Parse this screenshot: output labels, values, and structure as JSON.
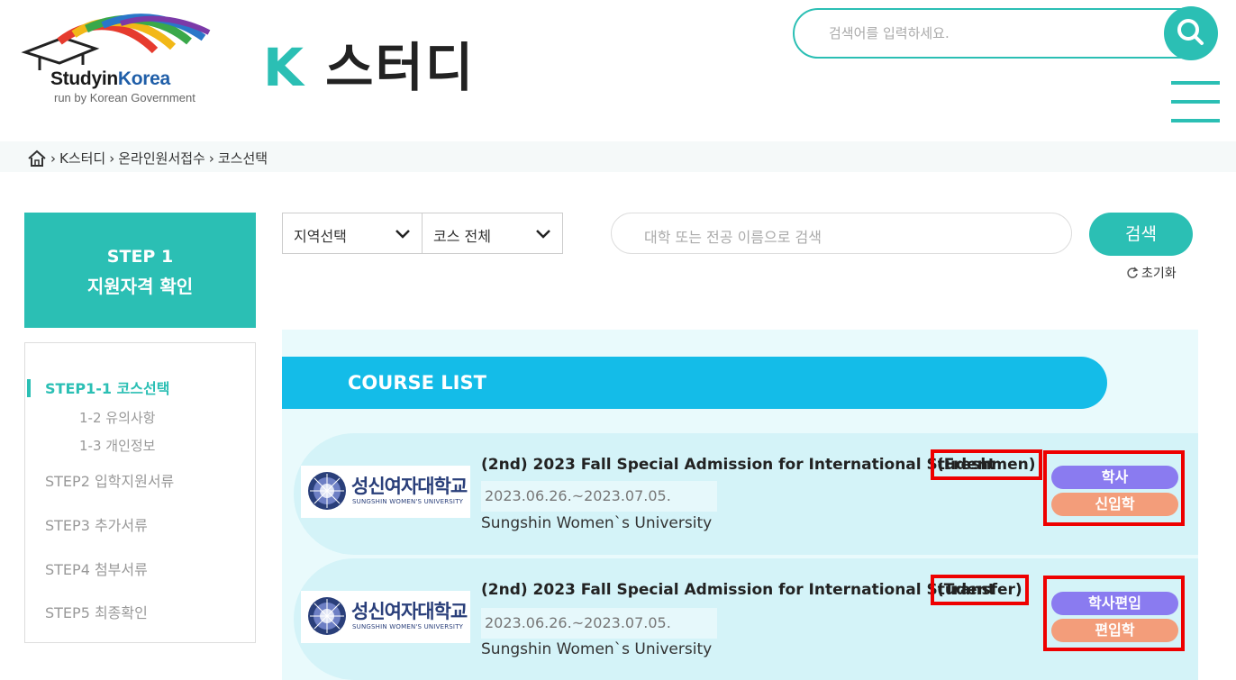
{
  "header": {
    "brand_study": "Studyin",
    "brand_korea": "Korea",
    "brand_sub": "run by Korean Government",
    "site_title_k": "K",
    "site_title_rest": "스터디",
    "search_placeholder": "검색어를 입력하세요."
  },
  "breadcrumb": {
    "items": [
      "K스터디",
      "온라인원서접수",
      "코스선택"
    ]
  },
  "sidebar": {
    "step_title": "STEP 1",
    "step_subtitle": "지원자격 확인",
    "nav": {
      "step1_1": "STEP1-1 코스선택",
      "sub_1_2": "1-2 유의사항",
      "sub_1_3": "1-3 개인정보",
      "step2": "STEP2 입학지원서류",
      "step3": "STEP3 추가서류",
      "step4": "STEP4 첨부서류",
      "step5": "STEP5 최종확인"
    }
  },
  "filters": {
    "region_select": "지역선택",
    "course_select": "코스 전체",
    "search_placeholder": "대학 또는 전공 이름으로 검색",
    "search_button": "검색",
    "reset": "초기화"
  },
  "course_list": {
    "heading": "COURSE LIST",
    "items": [
      {
        "title": "(2nd) 2023 Fall Special Admission for International Student",
        "tag": "(Freshmen)",
        "date": "2023.06.26.~2023.07.05.",
        "university": "Sungshin Women`s University",
        "logo_kr": "성신여자대학교",
        "logo_en": "SUNGSHIN WOMEN'S UNIVERSITY",
        "badge1": "학사",
        "badge2": "신입학"
      },
      {
        "title": "(2nd) 2023 Fall Special Admission for International Student",
        "tag": "(Transfer)",
        "date": "2023.06.26.~2023.07.05.",
        "university": "Sungshin Women`s University",
        "logo_kr": "성신여자대학교",
        "logo_en": "SUNGSHIN WOMEN'S UNIVERSITY",
        "badge1": "학사편입",
        "badge2": "편입학"
      }
    ]
  },
  "colors": {
    "teal": "#2bbfb4",
    "blue": "#14bce8",
    "purple": "#8a7bf0",
    "orange": "#f39d7a",
    "highlight_red": "#ee0000"
  }
}
